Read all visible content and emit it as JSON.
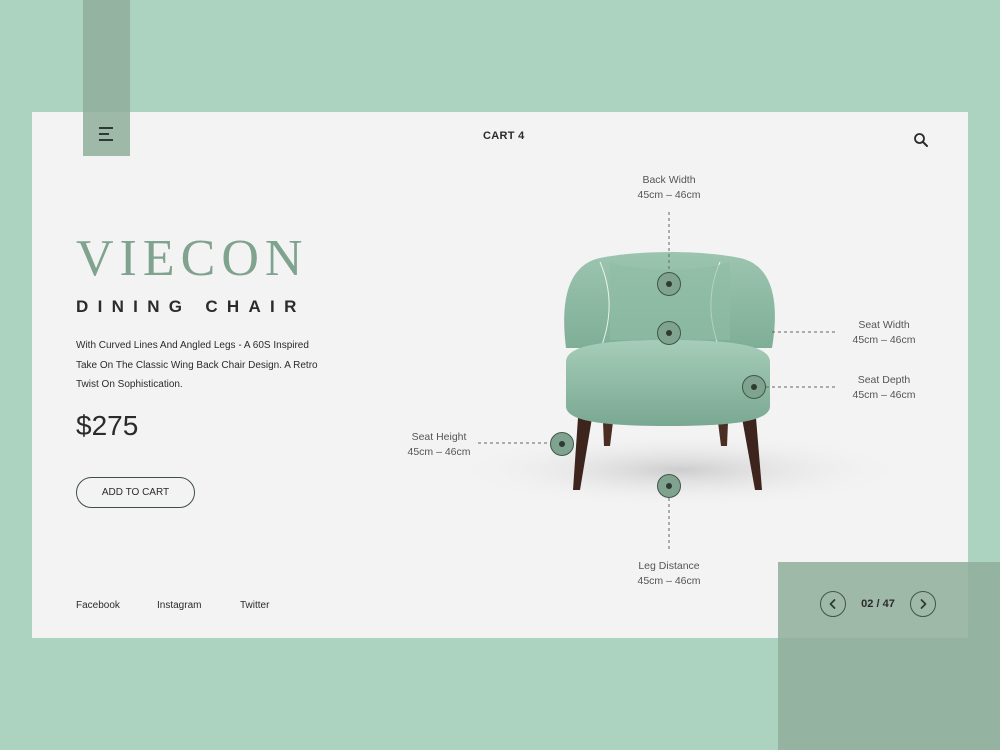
{
  "header": {
    "cart_label": "CART 4",
    "menu_icon": "hamburger-menu-icon",
    "search_icon": "search-icon"
  },
  "product": {
    "brand": "VIECON",
    "subtitle": "DINING CHAIR",
    "description": "With Curved Lines And Angled Legs - A 60S Inspired Take On The Classic Wing Back Chair Design. A Retro Twist On Sophistication.",
    "price": "$275",
    "add_to_cart_label": "ADD TO CART"
  },
  "social": {
    "facebook": "Facebook",
    "instagram": "Instagram",
    "twitter": "Twitter"
  },
  "dimensions": {
    "back_width": {
      "label": "Back Width",
      "value": "45cm – 46cm"
    },
    "seat_width": {
      "label": "Seat Width",
      "value": "45cm – 46cm"
    },
    "seat_depth": {
      "label": "Seat Depth",
      "value": "45cm – 46cm"
    },
    "seat_height": {
      "label": "Seat Height",
      "value": "45cm – 46cm"
    },
    "leg_distance": {
      "label": "Leg Distance",
      "value": "45cm – 46cm"
    }
  },
  "pager": {
    "current": "02",
    "total": "47",
    "display": "02 / 47"
  },
  "colors": {
    "background": "#acd3bf",
    "card": "#f3f3f3",
    "accent": "#7fa38e",
    "deco": "#8fae9b",
    "text": "#2b2b2b"
  }
}
